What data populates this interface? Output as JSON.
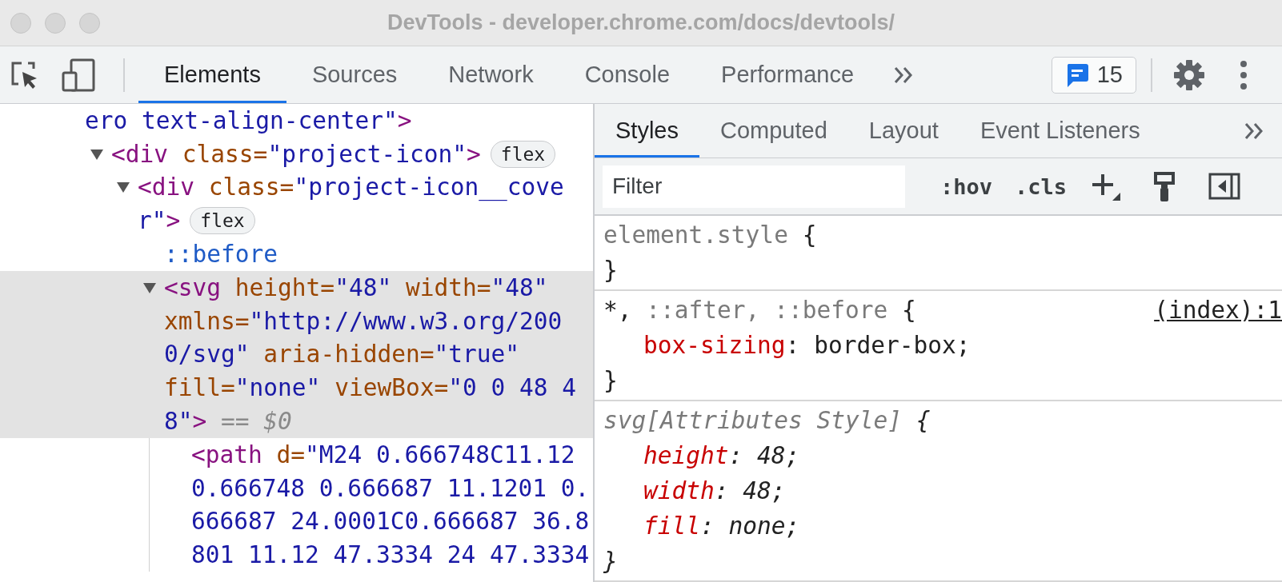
{
  "window": {
    "title": "DevTools - developer.chrome.com/docs/devtools/"
  },
  "toolbar": {
    "tabs": [
      {
        "label": "Elements",
        "selected": true
      },
      {
        "label": "Sources",
        "selected": false
      },
      {
        "label": "Network",
        "selected": false
      },
      {
        "label": "Console",
        "selected": false
      },
      {
        "label": "Performance",
        "selected": false
      }
    ],
    "issues_count": "15"
  },
  "elements_tree": [
    {
      "selected": false,
      "lines": [
        {
          "tokens": [
            {
              "kind": "value",
              "text": "ero text-align-center\""
            },
            {
              "kind": "tag",
              "text": ">"
            }
          ]
        }
      ],
      "children": [
        {
          "selected": false,
          "expanded": true,
          "lines": [
            {
              "tokens": [
                {
                  "kind": "tag",
                  "text": "<div"
                },
                {
                  "kind": "attr",
                  "text": " class="
                },
                {
                  "kind": "value",
                  "text": "\"project-icon\""
                },
                {
                  "kind": "tag",
                  "text": ">"
                }
              ],
              "badge": "flex"
            }
          ],
          "children": [
            {
              "selected": false,
              "expanded": true,
              "lines": [
                {
                  "tokens": [
                    {
                      "kind": "tag",
                      "text": "<div"
                    },
                    {
                      "kind": "attr",
                      "text": " class="
                    },
                    {
                      "kind": "value",
                      "text": "\"project-icon__cove"
                    }
                  ]
                },
                {
                  "tokens": [
                    {
                      "kind": "value",
                      "text": "r\""
                    },
                    {
                      "kind": "tag",
                      "text": ">"
                    }
                  ],
                  "badge": "flex"
                }
              ],
              "children": [
                {
                  "selected": false,
                  "lines": [
                    {
                      "tokens": [
                        {
                          "kind": "pseudo",
                          "text": "::before"
                        }
                      ]
                    }
                  ]
                },
                {
                  "selected": true,
                  "expanded": true,
                  "lines": [
                    {
                      "tokens": [
                        {
                          "kind": "tag",
                          "text": "<svg"
                        },
                        {
                          "kind": "attr",
                          "text": " height="
                        },
                        {
                          "kind": "value",
                          "text": "\"48\""
                        },
                        {
                          "kind": "attr",
                          "text": " width="
                        },
                        {
                          "kind": "value",
                          "text": "\"48\""
                        }
                      ]
                    },
                    {
                      "tokens": [
                        {
                          "kind": "attr",
                          "text": "xmlns="
                        },
                        {
                          "kind": "value",
                          "text": "\"http://www.w3.org/200"
                        }
                      ]
                    },
                    {
                      "tokens": [
                        {
                          "kind": "value",
                          "text": "0/svg\""
                        },
                        {
                          "kind": "attr",
                          "text": " aria-hidden="
                        },
                        {
                          "kind": "value",
                          "text": "\"true\""
                        }
                      ]
                    },
                    {
                      "tokens": [
                        {
                          "kind": "attr",
                          "text": "fill="
                        },
                        {
                          "kind": "value",
                          "text": "\"none\""
                        },
                        {
                          "kind": "attr",
                          "text": " viewBox="
                        },
                        {
                          "kind": "value",
                          "text": "\"0 0 48 4"
                        }
                      ]
                    },
                    {
                      "tokens": [
                        {
                          "kind": "value",
                          "text": "8\""
                        },
                        {
                          "kind": "tag",
                          "text": ">"
                        },
                        {
                          "kind": "dim",
                          "text": " == "
                        },
                        {
                          "kind": "dollar",
                          "text": "$0"
                        }
                      ]
                    }
                  ],
                  "children": [
                    {
                      "selected": false,
                      "lines": [
                        {
                          "tokens": [
                            {
                              "kind": "tag",
                              "text": "<path"
                            },
                            {
                              "kind": "attr",
                              "text": " d="
                            },
                            {
                              "kind": "value",
                              "text": "\"M24 0.666748C11.12"
                            }
                          ]
                        },
                        {
                          "tokens": [
                            {
                              "kind": "value",
                              "text": "0.666748 0.666687 11.1201 0."
                            }
                          ]
                        },
                        {
                          "tokens": [
                            {
                              "kind": "value",
                              "text": "666687 24.0001C0.666687 36.8"
                            }
                          ]
                        },
                        {
                          "tokens": [
                            {
                              "kind": "value",
                              "text": "801 11.12 47.3334 24 47.3334"
                            }
                          ]
                        }
                      ]
                    }
                  ]
                }
              ]
            }
          ]
        }
      ]
    }
  ],
  "styles_pane": {
    "tabs": [
      {
        "label": "Styles",
        "selected": true
      },
      {
        "label": "Computed",
        "selected": false
      },
      {
        "label": "Layout",
        "selected": false
      },
      {
        "label": "Event Listeners",
        "selected": false
      }
    ],
    "filter": {
      "placeholder": "Filter"
    },
    "hov": ":hov",
    "cls": ".cls",
    "rules": [
      {
        "italic": false,
        "lines": [
          [
            {
              "kind": "unmatched",
              "text": "element.style"
            },
            {
              "kind": "plain",
              "text": " {"
            }
          ],
          [
            {
              "kind": "plain",
              "text": "}"
            }
          ]
        ]
      },
      {
        "italic": false,
        "source": "(index):1",
        "lines": [
          [
            {
              "kind": "plain",
              "text": "*,"
            },
            {
              "kind": "unmatched",
              "text": " ::after, ::before"
            },
            {
              "kind": "plain",
              "text": " {"
            }
          ],
          [
            {
              "kind": "indent"
            },
            {
              "kind": "property",
              "text": "box-sizing"
            },
            {
              "kind": "plain",
              "text": ": border-box;"
            }
          ],
          [
            {
              "kind": "plain",
              "text": "}"
            }
          ]
        ]
      },
      {
        "italic": true,
        "lines": [
          [
            {
              "kind": "unmatched",
              "text": "svg[Attributes Style]"
            },
            {
              "kind": "plain",
              "text": " {"
            }
          ],
          [
            {
              "kind": "indent"
            },
            {
              "kind": "property",
              "text": "height"
            },
            {
              "kind": "plain",
              "text": ": 48;"
            }
          ],
          [
            {
              "kind": "indent"
            },
            {
              "kind": "property",
              "text": "width"
            },
            {
              "kind": "plain",
              "text": ": 48;"
            }
          ],
          [
            {
              "kind": "indent"
            },
            {
              "kind": "property",
              "text": "fill"
            },
            {
              "kind": "plain",
              "text": ": none;"
            }
          ],
          [
            {
              "kind": "plain",
              "text": "}"
            }
          ]
        ]
      }
    ]
  }
}
